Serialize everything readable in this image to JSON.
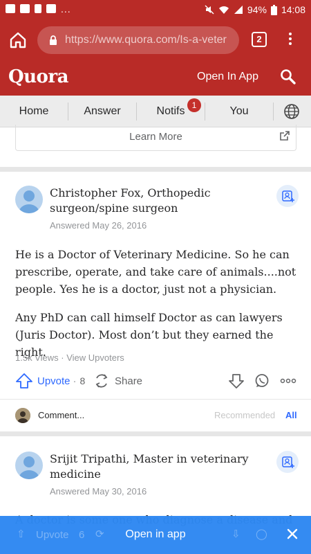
{
  "status_bar": {
    "battery": "94%",
    "time": "14:08",
    "more": "..."
  },
  "browser": {
    "url_domain": "https://www.quora.com",
    "url_path": "/Is-a-veter",
    "tab_count": "2"
  },
  "header": {
    "logo": "Quora",
    "open_in_app": "Open In App"
  },
  "nav": {
    "items": [
      {
        "label": "Home"
      },
      {
        "label": "Answer"
      },
      {
        "label": "Notifs",
        "badge": "1"
      },
      {
        "label": "You"
      }
    ]
  },
  "ad": {
    "learn_more": "Learn More"
  },
  "answers": [
    {
      "author": "Christopher Fox, Orthopedic surgeon/spine surgeon",
      "date": "Answered May 26, 2016",
      "paragraphs": [
        "He is a Doctor of Veterinary Medicine. So he can prescribe, operate, and take care of animals....not people. Yes he is a doctor, just not a physician.",
        "Any PhD can call himself Doctor as can lawyers (Juris Doctor). Most don’t but they earned the right."
      ],
      "views": "1.5k Views",
      "view_upvoters": "View Upvoters",
      "upvote_label": "Upvote",
      "upvote_count": "8",
      "share_label": "Share",
      "comment_placeholder": "Comment...",
      "recommended": "Recommended",
      "all": "All"
    },
    {
      "author": "Srijit Tripathi, Master in veterinary medicine",
      "date": "Answered May 30, 2016",
      "partial_text": "A doctor is some one who diagnose a disease and",
      "upvote_label": "Upvote",
      "upvote_count": "6",
      "share_label": "Share"
    }
  ],
  "banner": {
    "label": "Open in app"
  },
  "colors": {
    "brand": "#b92b27",
    "banner": "#2e88f2",
    "link": "#2e69ff"
  }
}
